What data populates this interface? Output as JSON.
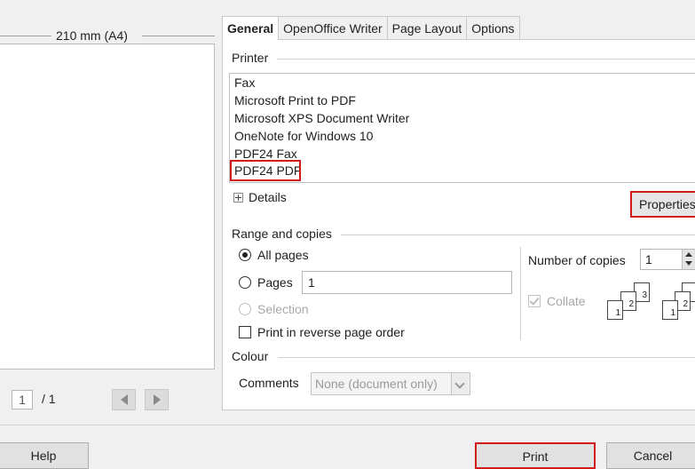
{
  "preview": {
    "dimension_label": "210 mm (A4)",
    "page_current": "1",
    "page_total": "/ 1"
  },
  "tabs": [
    {
      "label": "General",
      "active": true
    },
    {
      "label": "OpenOffice Writer",
      "active": false
    },
    {
      "label": "Page Layout",
      "active": false
    },
    {
      "label": "Options",
      "active": false
    }
  ],
  "printer": {
    "section_label": "Printer",
    "items": [
      "Fax",
      "Microsoft Print to PDF",
      "Microsoft XPS Document Writer",
      "OneNote for Windows 10",
      "PDF24 Fax",
      "PDF24 PDF"
    ],
    "selected": "PDF24 PDF",
    "details_label": "Details",
    "properties_label": "Properties..."
  },
  "range": {
    "section_label": "Range and copies",
    "all_pages_label": "All pages",
    "pages_label": "Pages",
    "pages_value": "1",
    "selection_label": "Selection",
    "reverse_label": "Print in reverse page order",
    "copies_label": "Number of copies",
    "copies_value": "1",
    "collate_label": "Collate"
  },
  "colour": {
    "section_label": "Colour",
    "comments_label": "Comments",
    "comments_value": "None (document only)"
  },
  "buttons": {
    "help": "Help",
    "print": "Print",
    "cancel": "Cancel"
  },
  "colors": {
    "highlight": "#d11a1a",
    "panel_bg": "#ffffff",
    "dialog_bg": "#f0f0f0"
  }
}
